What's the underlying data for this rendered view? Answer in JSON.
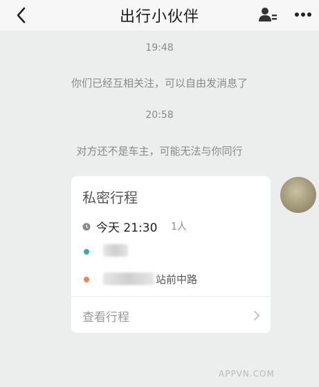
{
  "header": {
    "title": "出行小伙伴"
  },
  "messages": [
    {
      "time": "19:48",
      "text": "你们已经互相关注，可以自由发消息了"
    },
    {
      "time": "20:58",
      "text": "对方还不是车主，可能无法与你同行"
    }
  ],
  "trip_card": {
    "title": "私密行程",
    "time_label": "今天 21:30",
    "seats": "1人",
    "destination_suffix": "站前中路",
    "view_label": "查看行程"
  },
  "watermark": "APPVN.COM",
  "colors": {
    "start_dot": "#2bb39d",
    "end_dot": "#f0854a",
    "clock_dot": "#8b8b8b"
  },
  "icons": [
    "back-icon",
    "person-card-icon",
    "more-icon",
    "clock-icon",
    "chevron-right-icon"
  ]
}
